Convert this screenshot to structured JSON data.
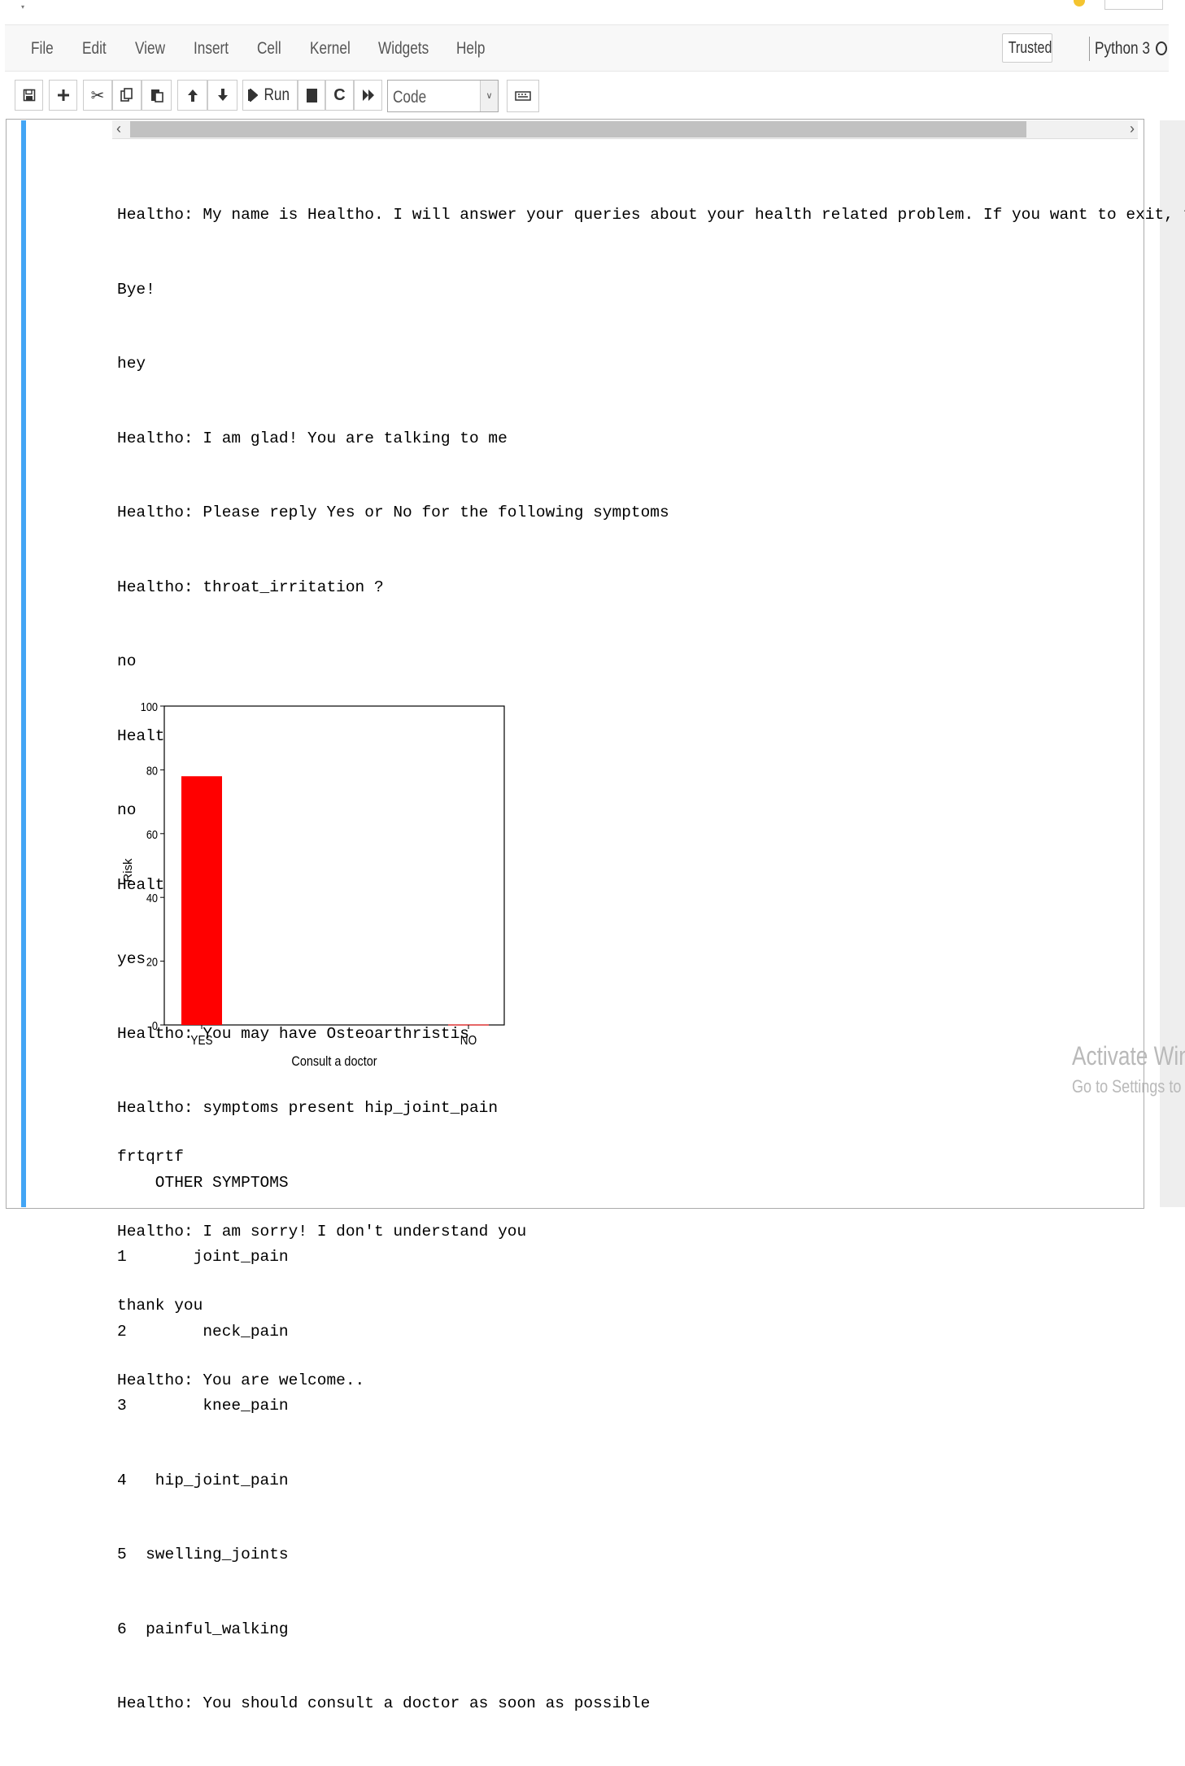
{
  "menubar": {
    "items": [
      "File",
      "Edit",
      "View",
      "Insert",
      "Cell",
      "Kernel",
      "Widgets",
      "Help"
    ],
    "trusted_label": "Trusted",
    "kernel_label": "Python 3"
  },
  "toolbar": {
    "buttons": [
      "save-icon",
      "plus-icon",
      "cut-icon",
      "copy-icon",
      "paste-icon",
      "arrow-up-icon",
      "arrow-down-icon",
      "run-icon",
      "stop-icon",
      "restart-icon",
      "fast-forward-icon",
      "keyboard-icon"
    ],
    "run_label": "Run",
    "cell_type": "Code"
  },
  "output": {
    "lines": [
      "Healtho: My name is Healtho. I will answer your queries about your health related problem. If you want to exit, type",
      "Bye!",
      "hey",
      "Healtho: I am glad! You are talking to me",
      "Healtho: Please reply Yes or No for the following symptoms",
      "Healtho: throat_irritation ?",
      "no",
      "Healtho: internal_itching ?",
      "no",
      "Healtho: hip_joint_pain ?",
      "yes",
      "Healtho: You may have Osteoarthristis",
      "Healtho: symptoms present hip_joint_pain",
      "    OTHER SYMPTOMS",
      "1       joint_pain",
      "2        neck_pain",
      "3        knee_pain",
      "4   hip_joint_pain",
      "5  swelling_joints",
      "6  painful_walking",
      "Healtho: You should consult a doctor as soon as possible"
    ],
    "after_chart_lines": [
      "frtqrtf",
      "Healtho: I am sorry! I don't understand you",
      "thank you",
      "Healtho: You are welcome.."
    ]
  },
  "chart_data": {
    "type": "bar",
    "categories": [
      "YES",
      "NO"
    ],
    "values": [
      78,
      0
    ],
    "xlabel": "Consult a doctor",
    "ylabel": "Risk",
    "ylim": [
      0,
      100
    ],
    "yticks": [
      0,
      20,
      40,
      60,
      80,
      100
    ],
    "bar_color": "#ff0000",
    "grid": false
  },
  "watermark": {
    "line1": "Activate Win",
    "line2": "Go to Settings to"
  },
  "colors": {
    "selected_cell_bar": "#42a5f5",
    "menubar_bg": "#f8f8f8"
  }
}
